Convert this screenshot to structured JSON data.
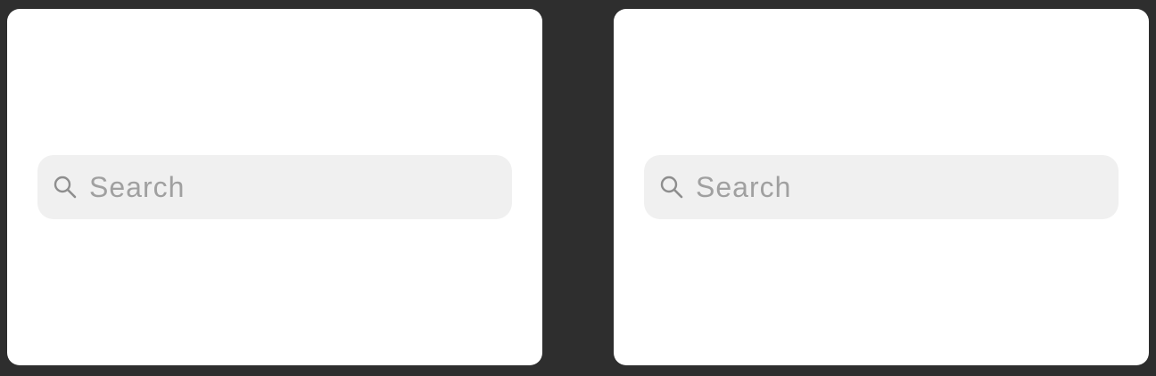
{
  "panels": [
    {
      "search": {
        "placeholder": "Search",
        "value": "",
        "icon": "search-icon"
      }
    },
    {
      "search": {
        "placeholder": "Search",
        "value": "",
        "icon": "search-icon"
      }
    }
  ],
  "colors": {
    "background": "#2e2e2e",
    "panel": "#ffffff",
    "search_field": "#f0f0f0",
    "placeholder_text": "#a0a0a0",
    "icon": "#8e8e8e"
  }
}
